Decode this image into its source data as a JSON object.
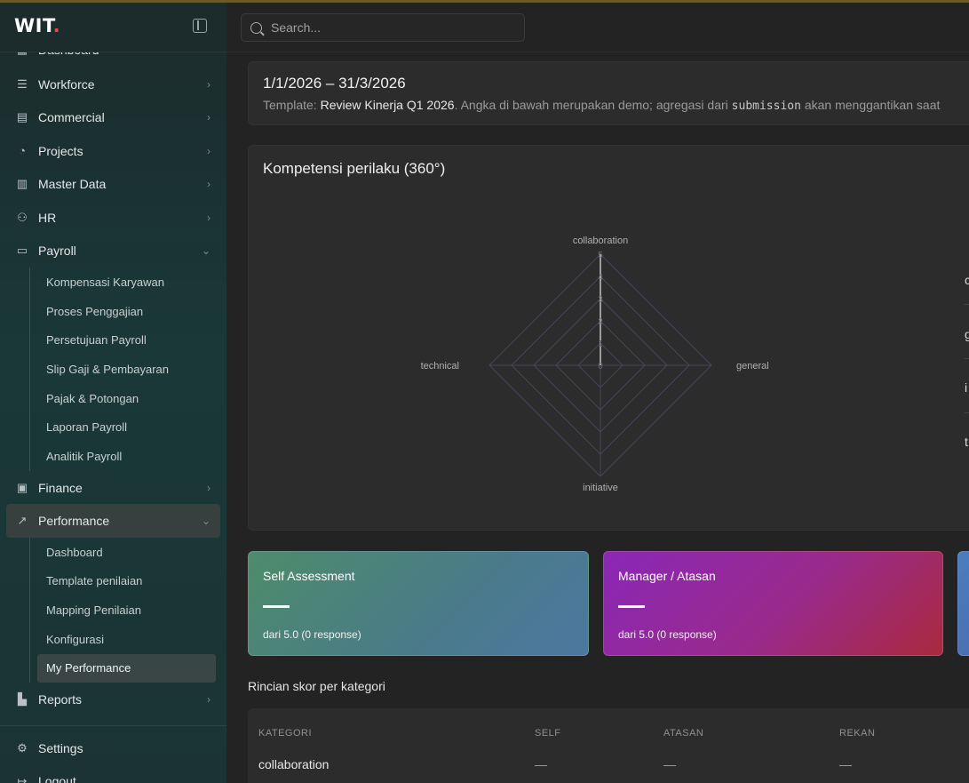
{
  "app": {
    "brand": "WIT",
    "brand_dot": "."
  },
  "search": {
    "placeholder": "Search..."
  },
  "sidebar": {
    "items": [
      {
        "label": "Dashboard",
        "icon": "grid-icon"
      },
      {
        "label": "Workforce",
        "icon": "list-icon"
      },
      {
        "label": "Commercial",
        "icon": "building-icon"
      },
      {
        "label": "Projects",
        "icon": "pie-icon"
      },
      {
        "label": "Master Data",
        "icon": "buildings-icon"
      },
      {
        "label": "HR",
        "icon": "users-icon"
      },
      {
        "label": "Payroll",
        "icon": "banknote-icon"
      }
    ],
    "payroll_sub": [
      "Kompensasi Karyawan",
      "Proses Penggajian",
      "Persetujuan Payroll",
      "Slip Gaji & Pembayaran",
      "Pajak & Potongan",
      "Laporan Payroll",
      "Analitik Payroll"
    ],
    "finance": "Finance",
    "performance": "Performance",
    "performance_sub": [
      "Dashboard",
      "Template penilaian",
      "Mapping Penilaian",
      "Konfigurasi",
      "My Performance"
    ],
    "reports": "Reports",
    "settings": "Settings",
    "logout": "Logout"
  },
  "period": {
    "range": "1/1/2026 – 31/3/2026",
    "template_label": "Template: ",
    "template_name": "Review Kinerja Q1 2026",
    "note_a": ". Angka di bawah merupakan demo; agregasi dari ",
    "note_code": "submission",
    "note_b": " akan menggantikan saat"
  },
  "radar": {
    "title": "Kompetensi perilaku (360°)",
    "right_labels": [
      "c",
      "g",
      "i",
      "t"
    ]
  },
  "chart_data": {
    "type": "radar",
    "categories": [
      "collaboration",
      "general",
      "initiative",
      "technical"
    ],
    "ticks": [
      "0",
      "1",
      "2",
      "3",
      "4",
      "5"
    ],
    "rlim": [
      0,
      5
    ],
    "series": [
      {
        "values": [
          0,
          0,
          0,
          0
        ]
      }
    ]
  },
  "scores": [
    {
      "title": "Self Assessment",
      "value": "—",
      "sub": "dari 5.0 (0 response)"
    },
    {
      "title": "Manager / Atasan",
      "value": "—",
      "sub": "dari 5.0 (0 response)"
    }
  ],
  "breakdown": {
    "title": "Rincian skor per kategori",
    "headers": [
      "KATEGORI",
      "SELF",
      "ATASAN",
      "REKAN"
    ],
    "rows": [
      {
        "kategori": "collaboration",
        "self": "—",
        "atasan": "—",
        "rekan": "—"
      }
    ]
  },
  "colors": {
    "accent_self": "#4d8c6a",
    "accent_manager": "#9a2a8a",
    "brand_dot": "#e5484d"
  }
}
